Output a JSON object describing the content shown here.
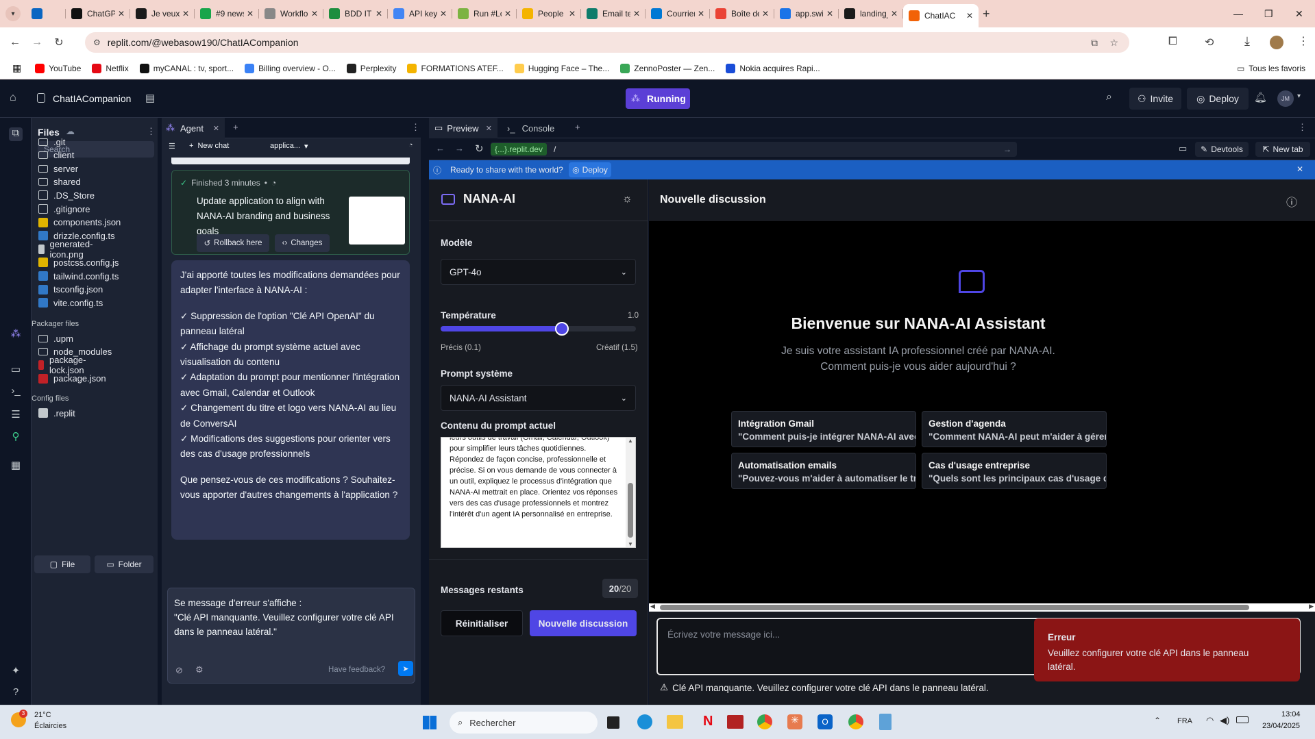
{
  "browser": {
    "tabs": [
      {
        "title": "",
        "color": "#0a66c2",
        "icon": "linkedin-icon"
      },
      {
        "title": "ChatGPT",
        "color": "#111111",
        "icon": "chatgpt-icon"
      },
      {
        "title": "Je veux c",
        "color": "#1a1a1a",
        "icon": "notion-icon"
      },
      {
        "title": "#9 newsl",
        "color": "#18a54a",
        "icon": "beehiiv-icon"
      },
      {
        "title": "Workflo",
        "color": "#888888",
        "icon": "n8n-icon"
      },
      {
        "title": "BDD IT \\",
        "color": "#1e8e3e",
        "icon": "sheets-icon"
      },
      {
        "title": "API keys",
        "color": "#4285f4",
        "icon": "google-icon"
      },
      {
        "title": "Run #Lo",
        "color": "#7cb342",
        "icon": "run-icon"
      },
      {
        "title": "People",
        "color": "#f4b400",
        "icon": "people-icon"
      },
      {
        "title": "Email te",
        "color": "#0e7c6b",
        "icon": "email-icon"
      },
      {
        "title": "Courrier",
        "color": "#0078d4",
        "icon": "outlook-icon"
      },
      {
        "title": "Boîte de",
        "color": "#ea4335",
        "icon": "gmail-icon"
      },
      {
        "title": "app.swi",
        "color": "#1a73e8",
        "icon": "swipe-icon"
      },
      {
        "title": "landing_",
        "color": "#1a1a1a",
        "icon": "landing-icon"
      },
      {
        "title": "ChatIAC",
        "color": "#f26207",
        "icon": "replit-icon"
      }
    ],
    "url": "replit.com/@webasow190/ChatIACompanion",
    "bookmarks": [
      {
        "label": "YouTube",
        "color": "#ff0000"
      },
      {
        "label": "Netflix",
        "color": "#e50914"
      },
      {
        "label": "myCANAL : tv, sport...",
        "color": "#111111"
      },
      {
        "label": "Billing overview - O...",
        "color": "#3b82f6"
      },
      {
        "label": "Perplexity",
        "color": "#222222"
      },
      {
        "label": "FORMATIONS ATEF...",
        "color": "#f4b400"
      },
      {
        "label": "Hugging Face – The...",
        "color": "#ffcc4d"
      },
      {
        "label": "ZennoPoster — Zen...",
        "color": "#3aa757"
      },
      {
        "label": "Nokia acquires Rapi...",
        "color": "#1a4dd8"
      }
    ],
    "all_bookmarks": "Tous les favoris"
  },
  "replit": {
    "project": "ChatIACompanion",
    "run_state": "Running",
    "invite": "Invite",
    "deploy": "Deploy",
    "avatar": "JM"
  },
  "files": {
    "title": "Files",
    "search_placeholder": "Search",
    "items": [
      ".git",
      "client",
      "server",
      "shared",
      ".DS_Store",
      ".gitignore",
      "components.json",
      "drizzle.config.ts",
      "generated-icon.png",
      "postcss.config.js",
      "tailwind.config.ts",
      "tsconfig.json",
      "vite.config.ts"
    ],
    "packager_title": "Packager files",
    "packager_items": [
      ".upm",
      "node_modules",
      "package-lock.json",
      "package.json"
    ],
    "config_title": "Config files",
    "config_items": [
      ".replit"
    ],
    "new_file": "File",
    "new_folder": "Folder"
  },
  "agent": {
    "tab": "Agent",
    "new_chat": "New chat",
    "app_selector": "applica...",
    "finished": "Finished 3 minutes",
    "checkpoint_text": "Update application to align with NANA-AI branding and business goals",
    "rollback": "Rollback here",
    "changes": "Changes",
    "message": [
      "J'ai apporté toutes les modifications demandées pour adapter l'interface à NANA-AI :",
      "✓ Suppression de l'option \"Clé API OpenAI\" du panneau latéral",
      "✓ Affichage du prompt système actuel avec visualisation du contenu",
      "✓ Adaptation du prompt pour mentionner l'intégration avec Gmail, Calendar et Outlook",
      "✓ Changement du titre et logo vers NANA-AI au lieu de ConversAI",
      "✓ Modifications des suggestions pour orienter vers des cas d'usage professionnels",
      "Que pensez-vous de ces modifications ? Souhaitez-vous apporter d'autres changements à l'application ?"
    ],
    "input_text": "Se message d'erreur s'affiche :\n\"Clé API manquante. Veuillez configurer votre clé API dans le panneau latéral.\"",
    "feedback": "Have feedback?"
  },
  "preview": {
    "tab_preview": "Preview",
    "tab_console": "Console",
    "url_domain": "{...}.replit.dev",
    "url_path": "/",
    "devtools": "Devtools",
    "new_tab": "New tab",
    "share_text": "Ready to share with the world?",
    "share_deploy": "Deploy"
  },
  "app": {
    "brand": "NANA-AI",
    "model_label": "Modèle",
    "model_value": "GPT-4o",
    "temperature_label": "Température",
    "temperature_value": "1.0",
    "temperature_fraction": 0.62,
    "temp_min": "Précis (0.1)",
    "temp_max": "Créatif (1.5)",
    "prompt_label": "Prompt système",
    "prompt_value": "NANA-AI Assistant",
    "prompt_content_label": "Contenu du prompt actuel",
    "prompt_content": "leurs outils de travail (Gmail, Calendar, Outlook) pour simplifier leurs tâches quotidiennes. Répondez de façon concise, professionnelle et précise. Si on vous demande de vous connecter à un outil, expliquez le processus d'intégration que NANA-AI mettrait en place. Orientez vos réponses vers des cas d'usage professionnels et montrez l'intérêt d'un agent IA personnalisé en entreprise.",
    "remaining_label": "Messages restants",
    "remaining_used": "20",
    "remaining_total": "/20",
    "reset": "Réinitialiser",
    "new_discussion": "Nouvelle discussion",
    "chat_title": "Nouvelle discussion",
    "welcome_title": "Bienvenue sur NANA-AI Assistant",
    "welcome_line1": "Je suis votre assistant IA professionnel créé par NANA-AI.",
    "welcome_line2": "Comment puis-je vous aider aujourd'hui ?",
    "suggestions": [
      {
        "title": "Intégration Gmail",
        "text": "\"Comment puis-je intégrer NANA-AI avec mon compte Gmail ?\""
      },
      {
        "title": "Gestion d'agenda",
        "text": "\"Comment NANA-AI peut m'aider à gérer mon calendrier et organiser mes réunions ?\""
      },
      {
        "title": "Automatisation emails",
        "text": "\"Pouvez-vous m'aider à automatiser le traitement de mes emails ?\""
      },
      {
        "title": "Cas d'usage entreprise",
        "text": "\"Quels sont les principaux cas d'usage de NANA-AI en entreprise ?\""
      }
    ],
    "input_placeholder": "Écrivez votre message ici...",
    "api_warning": "Clé API manquante. Veuillez configurer votre clé API dans le panneau latéral.",
    "toast_title": "Erreur",
    "toast_text": "Veuillez configurer votre clé API dans le panneau latéral."
  },
  "taskbar": {
    "weather_temp": "21°C",
    "weather_desc": "Éclaircies",
    "weather_badge": "3",
    "search_placeholder": "Rechercher",
    "lang": "FRA",
    "time": "13:04",
    "date": "23/04/2025"
  },
  "colors": {
    "accent": "#4f46e5",
    "replit_running": "#5b3fd6",
    "deploy_bar": "#1b5fc2",
    "toast": "#8b1515"
  }
}
